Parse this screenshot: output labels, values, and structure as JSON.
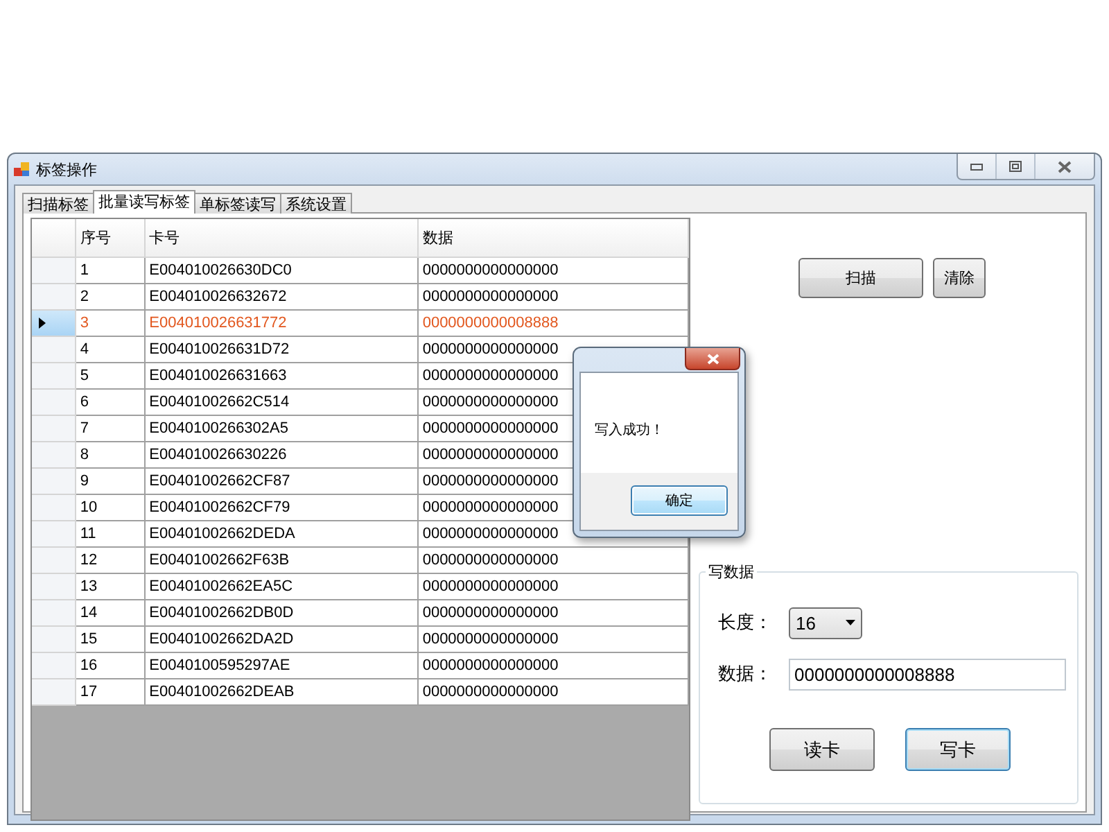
{
  "window": {
    "title": "标签操作"
  },
  "tabs": [
    {
      "label": "扫描标签",
      "selected": false
    },
    {
      "label": "批量读写标签",
      "selected": true
    },
    {
      "label": "单标签读写",
      "selected": false
    },
    {
      "label": "系统设置",
      "selected": false
    }
  ],
  "table": {
    "columns": [
      "序号",
      "卡号",
      "数据"
    ],
    "rows": [
      {
        "cells": [
          "1",
          "E004010026630DC0",
          "0000000000000000"
        ],
        "selected": false
      },
      {
        "cells": [
          "2",
          "E004010026632672",
          "0000000000000000"
        ],
        "selected": false
      },
      {
        "cells": [
          "3",
          "E004010026631772",
          "0000000000008888"
        ],
        "selected": true
      },
      {
        "cells": [
          "4",
          "E004010026631D72",
          "0000000000000000"
        ],
        "selected": false
      },
      {
        "cells": [
          "5",
          "E004010026631663",
          "0000000000000000"
        ],
        "selected": false
      },
      {
        "cells": [
          "6",
          "E00401002662C514",
          "0000000000000000"
        ],
        "selected": false
      },
      {
        "cells": [
          "7",
          "E0040100266302A5",
          "0000000000000000"
        ],
        "selected": false
      },
      {
        "cells": [
          "8",
          "E004010026630226",
          "0000000000000000"
        ],
        "selected": false
      },
      {
        "cells": [
          "9",
          "E00401002662CF87",
          "0000000000000000"
        ],
        "selected": false
      },
      {
        "cells": [
          "10",
          "E00401002662CF79",
          "0000000000000000"
        ],
        "selected": false
      },
      {
        "cells": [
          "11",
          "E00401002662DEDA",
          "0000000000000000"
        ],
        "selected": false
      },
      {
        "cells": [
          "12",
          "E00401002662F63B",
          "0000000000000000"
        ],
        "selected": false
      },
      {
        "cells": [
          "13",
          "E00401002662EA5C",
          "0000000000000000"
        ],
        "selected": false
      },
      {
        "cells": [
          "14",
          "E00401002662DB0D",
          "0000000000000000"
        ],
        "selected": false
      },
      {
        "cells": [
          "15",
          "E00401002662DA2D",
          "0000000000000000"
        ],
        "selected": false
      },
      {
        "cells": [
          "16",
          "E0040100595297AE",
          "0000000000000000"
        ],
        "selected": false
      },
      {
        "cells": [
          "17",
          "E00401002662DEAB",
          "0000000000000000"
        ],
        "selected": false
      }
    ]
  },
  "scan_buttons": [
    {
      "label": "扫描"
    },
    {
      "label": "清除"
    }
  ],
  "write_group": {
    "title": "写数据",
    "length_label": "长度：",
    "length_value": "16",
    "data_label": "数据：",
    "data_value": "0000000000008888",
    "buttons": [
      {
        "label": "读卡",
        "focused": false
      },
      {
        "label": "写卡",
        "focused": true
      }
    ]
  },
  "dialog": {
    "message": "写入成功！",
    "button": "确定"
  }
}
